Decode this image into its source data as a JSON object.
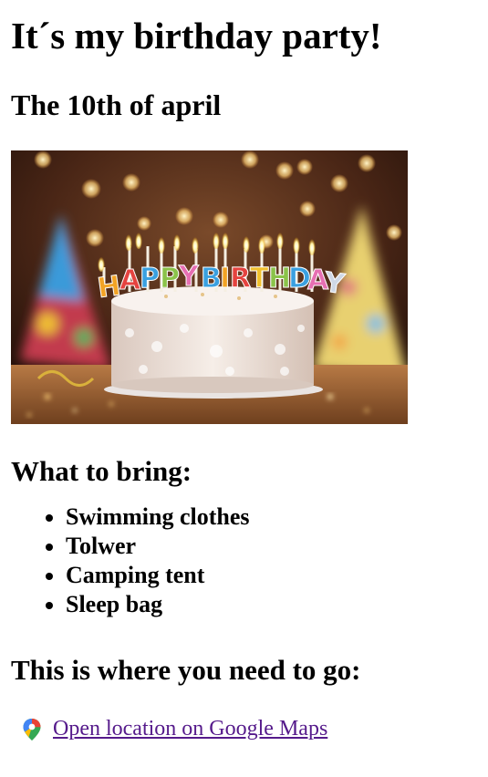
{
  "header": {
    "title": "It´s my birthday party!",
    "date": "The 10th of april"
  },
  "image": {
    "alt": "Birthday cake with HAPPY BIRTHDAY candles"
  },
  "bring": {
    "heading": "What to bring:",
    "items": [
      "Swimming clothes",
      "Tolwer",
      "Camping tent",
      "Sleep bag"
    ]
  },
  "location": {
    "heading": "This is where you need to go:",
    "link_label": "Open location on Google Maps",
    "icon": "google-maps-pin-icon"
  },
  "colors": {
    "link": "#551a8b",
    "text": "#000000",
    "background": "#ffffff"
  }
}
